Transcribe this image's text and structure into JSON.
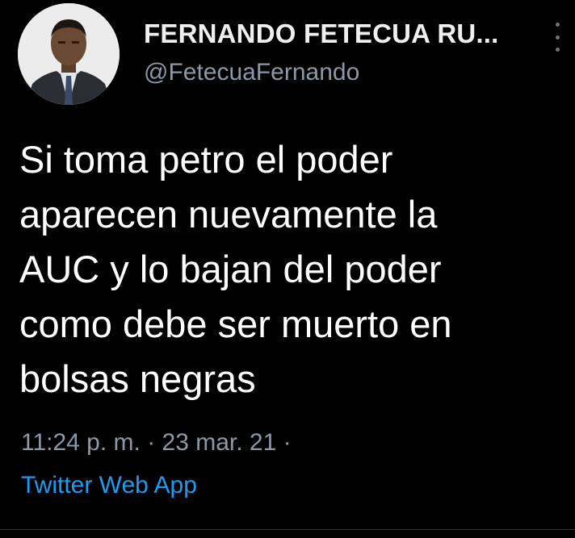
{
  "user": {
    "display_name": "FERNANDO FETECUA RU...",
    "handle": "@FetecuaFernando",
    "avatar_icon": "profile-photo-icon"
  },
  "tweet": {
    "lines": [
      "Si toma petro el poder",
      "aparecen nuevamente la",
      "AUC y lo bajan del poder",
      "como debe ser muerto en",
      "bolsas negras"
    ],
    "time": "11:24 p. m.",
    "date": "23 mar. 21",
    "source": "Twitter Web App"
  },
  "colors": {
    "background": "#000000",
    "text": "#ffffff",
    "secondary": "#8b98a5",
    "link": "#1d9bf0"
  }
}
